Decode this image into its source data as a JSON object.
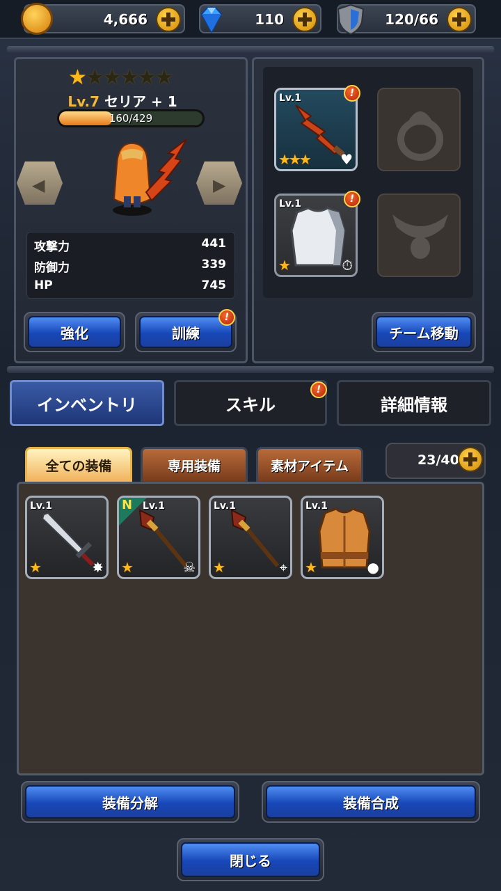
{
  "resources": {
    "gold": "4,666",
    "gems": "110",
    "stamina": "120/66"
  },
  "hero": {
    "stars_total": 6,
    "stars_filled": 1,
    "level_label": "Lv.7",
    "name": "セリア + 1",
    "xp_text": "160/429",
    "xp_fraction": 0.373,
    "stats": [
      {
        "label": "攻撃力",
        "value": "441"
      },
      {
        "label": "防御力",
        "value": "339"
      },
      {
        "label": "HP",
        "value": "745"
      }
    ],
    "enhance_label": "強化",
    "train_label": "訓練"
  },
  "equipment": {
    "weapon": {
      "level": "Lv.1",
      "stars": "★★★",
      "icon": "heart-icon"
    },
    "armor": {
      "level": "Lv.1",
      "stars": "★",
      "icon": "stopwatch-icon"
    },
    "ring_icon": "ring-icon",
    "necklace_icon": "necklace-icon",
    "team_move_label": "チーム移動"
  },
  "tabs": [
    {
      "label": "インベントリ",
      "active": true
    },
    {
      "label": "スキル",
      "active": false
    },
    {
      "label": "詳細情報",
      "active": false
    }
  ],
  "subtabs": [
    {
      "label": "全ての装備",
      "active": true
    },
    {
      "label": "専用装備",
      "active": false
    },
    {
      "label": "素材アイテム",
      "active": false
    }
  ],
  "inventory": {
    "count": "23/40",
    "items": [
      {
        "level": "Lv.1",
        "stars": "★",
        "kind": "sword",
        "badge": "✸",
        "new": ""
      },
      {
        "level": "Lv.1",
        "stars": "★",
        "kind": "staff",
        "badge": "☠",
        "new": "N"
      },
      {
        "level": "Lv.1",
        "stars": "★",
        "kind": "staff",
        "badge": "⌖",
        "new": ""
      },
      {
        "level": "Lv.1",
        "stars": "★",
        "kind": "vest",
        "badge": "♜",
        "new": ""
      }
    ]
  },
  "actions": {
    "disassemble_label": "装備分解",
    "synthesize_label": "装備合成",
    "close_label": "閉じる"
  },
  "notification_mark": "!"
}
